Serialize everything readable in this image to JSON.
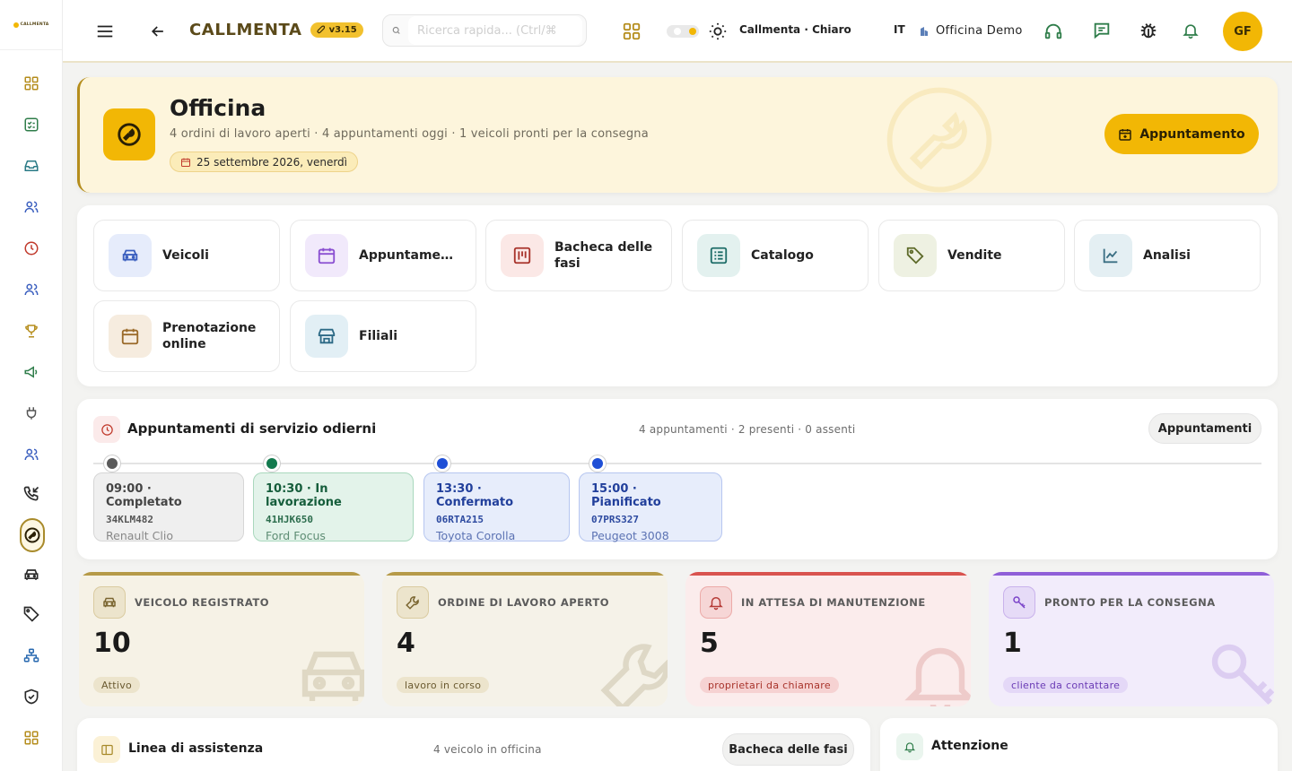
{
  "app": {
    "brand": "CALLMENTA",
    "version": "v3.15",
    "logo_text": "CALLMENTA"
  },
  "topbar": {
    "search_placeholder": "Ricerca rapida... (Ctrl/⌘",
    "theme_label": "Callmenta · Chiaro",
    "language": "IT",
    "workspace": "Officina Demo",
    "avatar_initials": "GF"
  },
  "hero": {
    "title": "Officina",
    "subtitle": "4 ordini di lavoro aperti · 4 appuntamenti oggi · 1 veicoli pronti per la consegna",
    "date": "25 settembre 2026, venerdì",
    "button": "Appuntamento"
  },
  "modules": [
    {
      "label": "Veicoli",
      "icon": "car-icon",
      "color": "#3b5fbf",
      "bg": "#e6ecfb"
    },
    {
      "label": "Appuntame…",
      "icon": "calendar-icon",
      "color": "#8a4fd1",
      "bg": "#f1e9fb"
    },
    {
      "label": "Bacheca delle fasi",
      "icon": "kanban-icon",
      "color": "#a8332b",
      "bg": "#fbe8e6"
    },
    {
      "label": "Catalogo",
      "icon": "catalog-icon",
      "color": "#1f6e69",
      "bg": "#e3f1ef"
    },
    {
      "label": "Vendite",
      "icon": "tag-icon",
      "color": "#5e6b2a",
      "bg": "#eef1e2"
    },
    {
      "label": "Analisi",
      "icon": "chart-icon",
      "color": "#3a6f83",
      "bg": "#e4eff3"
    },
    {
      "label": "Prenotazione online",
      "icon": "calendar-icon",
      "color": "#9a6a2a",
      "bg": "#f6ecdf"
    },
    {
      "label": "Filiali",
      "icon": "store-icon",
      "color": "#2d6a86",
      "bg": "#e2eff5"
    }
  ],
  "appointments": {
    "title": "Appuntamenti di servizio odierni",
    "meta": "4 appuntamenti · 2 presenti · 0 assenti",
    "button": "Appuntamenti",
    "items": [
      {
        "time_status": "09:00 · Completato",
        "plate": "34KLM482",
        "model": "Renault Clio",
        "dot": "#5a5a5a",
        "bg": "#efefef",
        "border": "#d6d6d6",
        "tc": "#444",
        "pc": "#555",
        "mc": "#888"
      },
      {
        "time_status": "10:30 · In lavorazione",
        "plate": "41HJK650",
        "model": "Ford Focus",
        "dot": "#137a4e",
        "bg": "#e3f3ea",
        "border": "#a9d8bd",
        "tc": "#155d3b",
        "pc": "#2c6d4d",
        "mc": "#5e8d74"
      },
      {
        "time_status": "13:30 · Confermato",
        "plate": "06RTA215",
        "model": "Toyota Corolla",
        "dot": "#1f4fd6",
        "bg": "#e7edfb",
        "border": "#b6c6f0",
        "tc": "#213f9b",
        "pc": "#2d4aa0",
        "mc": "#5b72b3"
      },
      {
        "time_status": "15:00 · Pianificato",
        "plate": "07PRS327",
        "model": "Peugeot 3008",
        "dot": "#1f4fd6",
        "bg": "#e7edfb",
        "border": "#b6c6f0",
        "tc": "#213f9b",
        "pc": "#2d4aa0",
        "mc": "#5b72b3"
      }
    ]
  },
  "stats": [
    {
      "label": "VEICOLO REGISTRATO",
      "value": "10",
      "badge": "Attivo",
      "icon": "car-icon",
      "accent": "#b69a48",
      "bg": "#f6f2e6",
      "ibg": "#ece4cc",
      "ic": "#7a6530",
      "bbg": "#ece4cc",
      "bc": "#6a5a30"
    },
    {
      "label": "ORDINE DI LAVORO APERTO",
      "value": "4",
      "badge": "lavoro in corso",
      "icon": "wrench-icon",
      "accent": "#b69a48",
      "bg": "#f5f2e8",
      "ibg": "#ece4cc",
      "ic": "#7a6530",
      "bbg": "#ece4cc",
      "bc": "#6a5a30"
    },
    {
      "label": "IN ATTESA DI MANUTENZIONE",
      "value": "5",
      "badge": "proprietari da chiamare",
      "icon": "bell-icon",
      "accent": "#d9534f",
      "bg": "#fbecec",
      "ibg": "#f6d6d6",
      "ic": "#b53a36",
      "bbg": "#f6d2d2",
      "bc": "#a8332b"
    },
    {
      "label": "PRONTO PER LA CONSEGNA",
      "value": "1",
      "badge": "cliente da contattare",
      "icon": "key-icon",
      "accent": "#8f5fd8",
      "bg": "#f2ecfb",
      "ibg": "#e6dbf7",
      "ic": "#7a43c9",
      "bbg": "#e4d8f7",
      "bc": "#6a3bb5"
    }
  ],
  "service_line": {
    "title": "Linea di assistenza",
    "meta": "4 veicolo in officina",
    "button": "Bacheca delle fasi"
  },
  "attention": {
    "title": "Attenzione"
  }
}
